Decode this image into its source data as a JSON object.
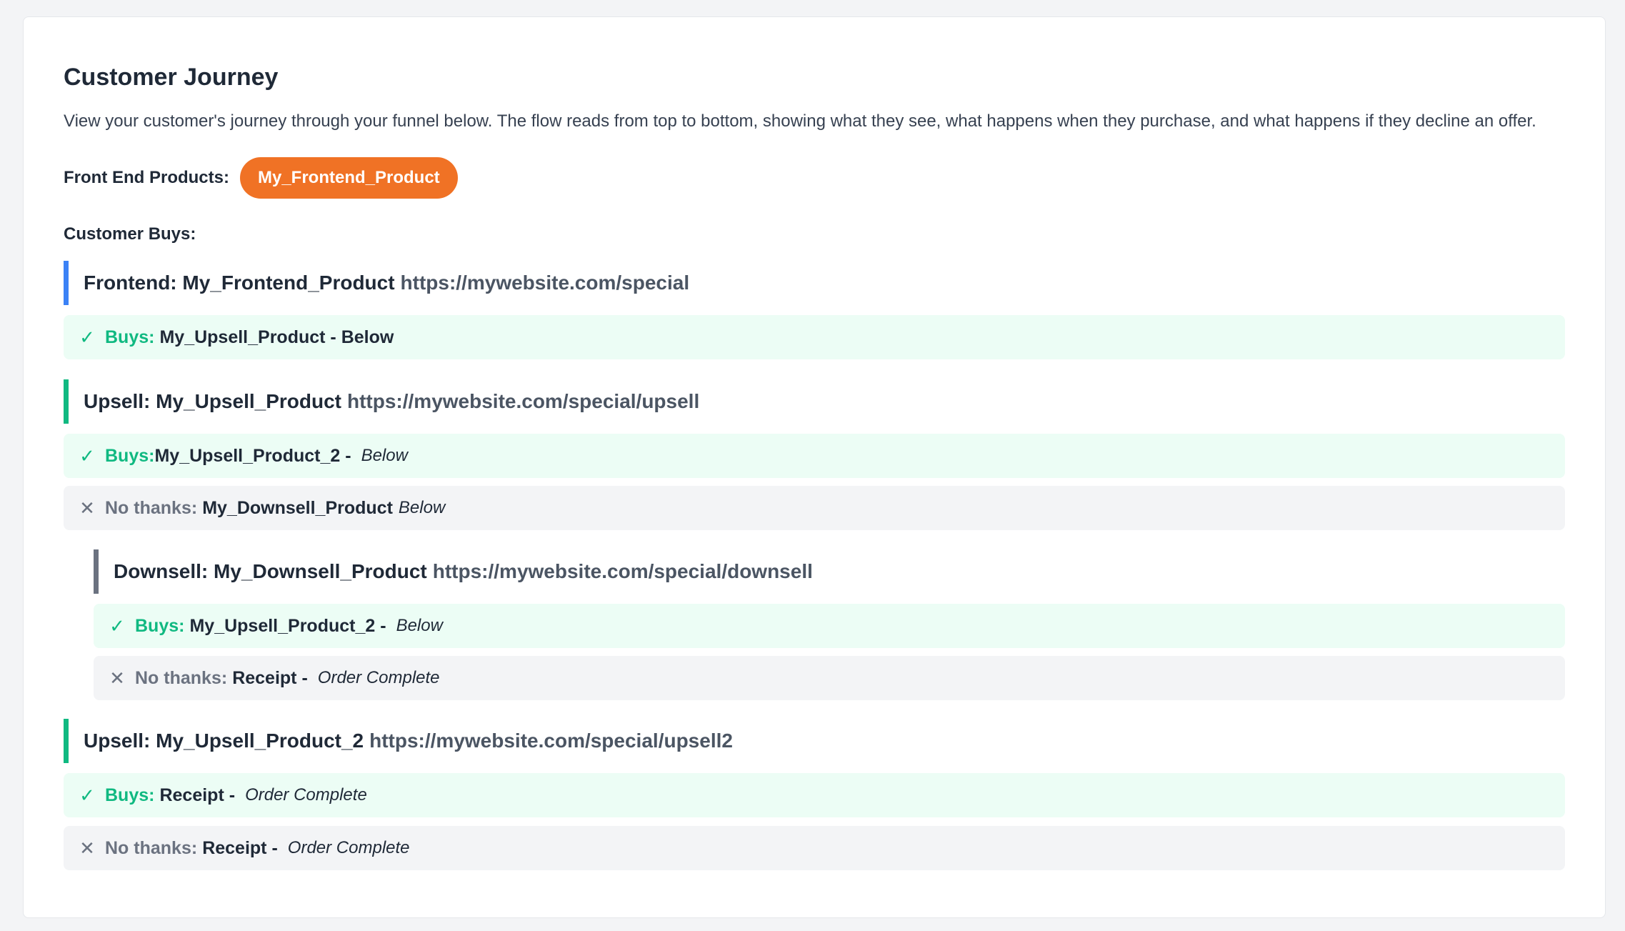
{
  "title": "Customer Journey",
  "description": "View your customer's journey through your funnel below. The flow reads from top to bottom, showing what they see, what happens when they purchase, and what happens if they decline an offer.",
  "front_end_label": "Front End Products:",
  "front_end_product": "My_Frontend_Product",
  "customer_buys_label": "Customer Buys:",
  "colors": {
    "pill": "#f07225",
    "frontend_bar": "#3b82f6",
    "upsell_bar": "#10b981",
    "downsell_bar": "#6b7280",
    "buy_bg": "#ecfdf5",
    "no_bg": "#f3f4f6"
  },
  "steps": {
    "frontend": {
      "title": "Frontend: My_Frontend_Product",
      "url": "https://mywebsite.com/special",
      "buy": {
        "label": "Buys:",
        "target": "My_Upsell_Product - Below",
        "dest": ""
      }
    },
    "upsell1": {
      "title": "Upsell: My_Upsell_Product",
      "url": "https://mywebsite.com/special/upsell",
      "buy": {
        "label": "Buys:",
        "target": "My_Upsell_Product_2 -",
        "dest": "Below"
      },
      "no": {
        "label": "No thanks:",
        "target": "My_Downsell_Product",
        "dest": "Below"
      }
    },
    "downsell": {
      "title": "Downsell: My_Downsell_Product",
      "url": "https://mywebsite.com/special/downsell",
      "buy": {
        "label": "Buys:",
        "target": "My_Upsell_Product_2 -",
        "dest": "Below"
      },
      "no": {
        "label": "No thanks:",
        "target": "Receipt -",
        "dest": "Order Complete"
      }
    },
    "upsell2": {
      "title": "Upsell: My_Upsell_Product_2",
      "url": "https://mywebsite.com/special/upsell2",
      "buy": {
        "label": "Buys:",
        "target": "Receipt -",
        "dest": "Order Complete"
      },
      "no": {
        "label": "No thanks:",
        "target": "Receipt -",
        "dest": "Order Complete"
      }
    }
  },
  "icons": {
    "buy": "check-icon",
    "no": "x-icon"
  }
}
